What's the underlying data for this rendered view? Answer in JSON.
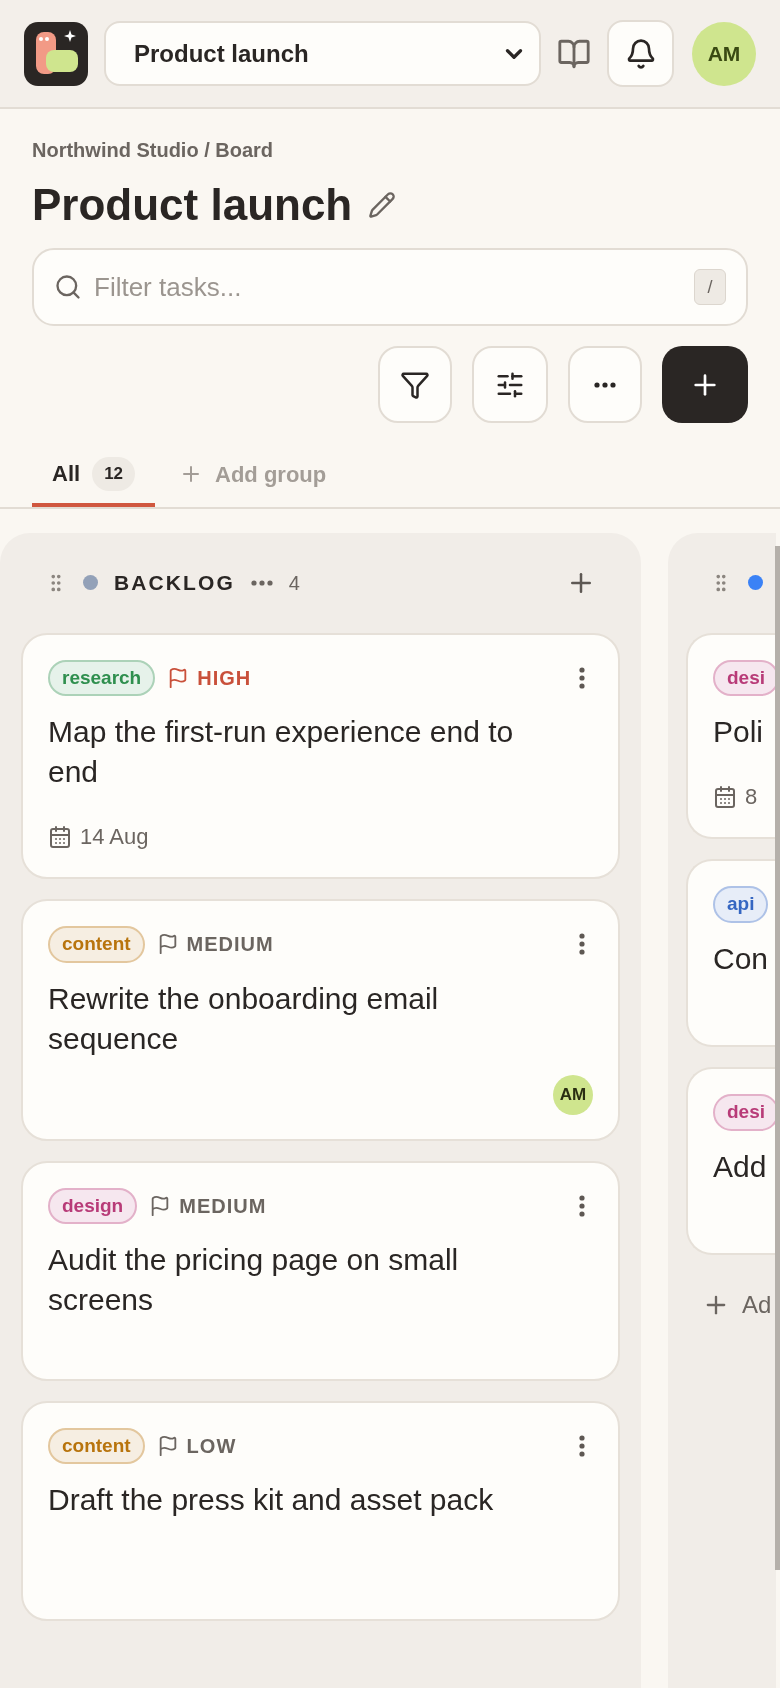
{
  "header": {
    "project_select": "Product launch",
    "avatar": "AM"
  },
  "breadcrumb": "Northwind Studio / Board",
  "title": "Product launch",
  "search": {
    "placeholder": "Filter tasks...",
    "shortcut": "/"
  },
  "tabs": [
    {
      "label": "All",
      "count": "12",
      "selected": true
    }
  ],
  "add_group": "Add group",
  "columns": [
    {
      "name": "BACKLOG",
      "color": "#93a1b8",
      "count": "4",
      "cards": [
        {
          "tag": {
            "label": "research",
            "color": "#2f8f4e"
          },
          "priority": {
            "label": "HIGH",
            "kind": "high"
          },
          "title": "Map the first-run experience end to end",
          "due": "14 Aug"
        },
        {
          "tag": {
            "label": "content",
            "color": "#b8740d"
          },
          "priority": {
            "label": "MEDIUM",
            "kind": "medium"
          },
          "title": "Rewrite the onboarding email sequence",
          "assignee": "AM"
        },
        {
          "tag": {
            "label": "design",
            "color": "#b83b78"
          },
          "priority": {
            "label": "MEDIUM",
            "kind": "medium"
          },
          "title": "Audit the pricing page on small screens"
        },
        {
          "tag": {
            "label": "content",
            "color": "#b8740d"
          },
          "priority": {
            "label": "LOW",
            "kind": "low"
          },
          "title": "Draft the press kit and asset pack"
        }
      ]
    },
    {
      "color": "#3b82f6",
      "add_card": "Ad",
      "cards": [
        {
          "tag": {
            "label": "desi",
            "color": "#b83b78"
          },
          "title": "Poli",
          "due": "8"
        },
        {
          "tag": {
            "label": "api",
            "color": "#3566c2"
          },
          "title": "Con"
        },
        {
          "tag": {
            "label": "desi",
            "color": "#b83b78"
          },
          "title": "Add"
        }
      ]
    }
  ]
}
